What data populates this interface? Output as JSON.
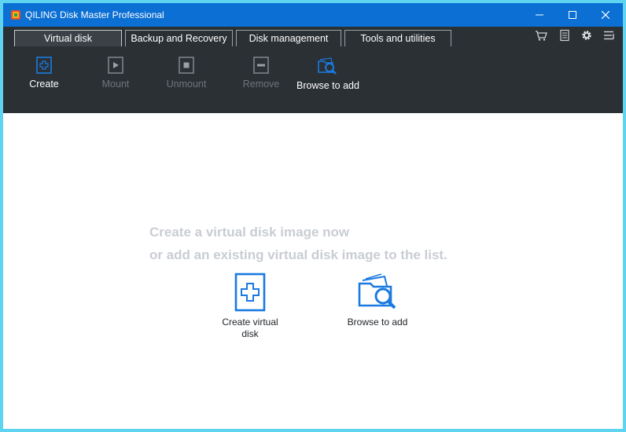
{
  "window": {
    "title": "QILING Disk Master Professional",
    "accent": "#0b6fd3",
    "toolbar_bg": "#2b3034"
  },
  "tabs": [
    {
      "label": "Virtual disk",
      "active": true
    },
    {
      "label": "Backup and Recovery",
      "active": false
    },
    {
      "label": "Disk management",
      "active": false
    },
    {
      "label": "Tools and utilities",
      "active": false
    }
  ],
  "tab_icons": [
    "cart-icon",
    "notes-icon",
    "settings-icon",
    "menu-icon"
  ],
  "toolbar": {
    "create": {
      "label": "Create",
      "icon": "plus-icon",
      "enabled": true
    },
    "mount": {
      "label": "Mount",
      "icon": "play-icon",
      "enabled": false
    },
    "unmount": {
      "label": "Unmount",
      "icon": "stop-icon",
      "enabled": false
    },
    "remove": {
      "label": "Remove",
      "icon": "minus-icon",
      "enabled": false
    },
    "browse": {
      "label": "Browse to add",
      "icon": "folder-search-icon",
      "enabled": true
    }
  },
  "main": {
    "line1": "Create a virtual disk image now",
    "line2": "or add an existing virtual disk image to the list.",
    "create_label_1": "Create virtual",
    "create_label_2": "disk",
    "browse_label": "Browse to add"
  }
}
